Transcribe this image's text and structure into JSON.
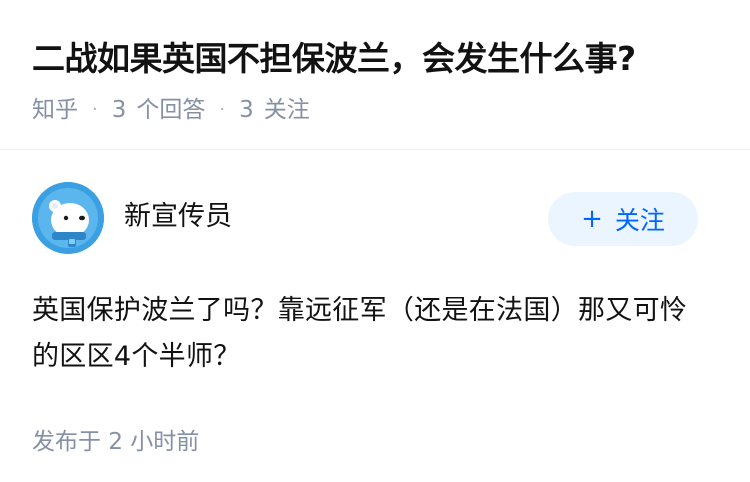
{
  "question": {
    "title": "二战如果英国不担保波兰，会发生什么事?",
    "source": "知乎",
    "answer_count": "3",
    "answer_label": "个回答",
    "follow_count": "3",
    "follow_label": "关注"
  },
  "answer": {
    "author_name": "新宣传员",
    "follow_button_label": "关注",
    "content": "英国保护波兰了吗？靠远征军（还是在法国）那又可怜的区区4个半师？",
    "time_prefix": "发布于",
    "time_value": "2 小时前"
  },
  "colors": {
    "accent": "#0066ff",
    "accent_bg": "#ebf5ff",
    "meta_text": "#8590a6",
    "avatar_bg": "#3aa0e2"
  },
  "icons": {
    "avatar": "polar-bear-avatar",
    "follow": "plus-icon",
    "separator": "dot-separator"
  }
}
